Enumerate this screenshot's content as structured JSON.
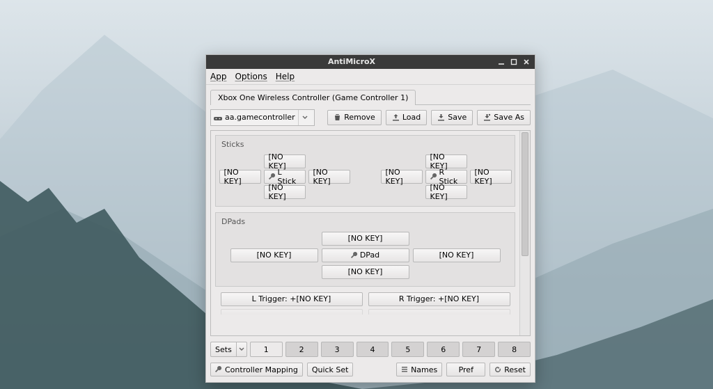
{
  "window": {
    "title": "AntiMicroX"
  },
  "menubar": {
    "app": "App",
    "options": "Options",
    "help": "Help"
  },
  "tab": {
    "label": "Xbox One Wireless Controller (Game Controller 1)"
  },
  "profile_combo": {
    "value": "aa.gamecontroller"
  },
  "toolbar": {
    "remove": "Remove",
    "load": "Load",
    "save": "Save",
    "save_as": "Save As"
  },
  "groups": {
    "sticks": {
      "title": "Sticks",
      "left": {
        "up": "[NO KEY]",
        "left": "[NO KEY]",
        "center": "L Stick",
        "right": "[NO KEY]",
        "down": "[NO KEY]"
      },
      "right": {
        "up": "[NO KEY]",
        "left": "[NO KEY]",
        "center": "R Stick",
        "right": "[NO KEY]",
        "down": "[NO KEY]"
      }
    },
    "dpads": {
      "title": "DPads",
      "up": "[NO KEY]",
      "left": "[NO KEY]",
      "center": "DPad",
      "right": "[NO KEY]",
      "down": "[NO KEY]"
    },
    "triggers": {
      "left": "L Trigger: +[NO KEY]",
      "right": "R Trigger: +[NO KEY]"
    }
  },
  "sets": {
    "label": "Sets",
    "buttons": [
      "1",
      "2",
      "3",
      "4",
      "5",
      "6",
      "7",
      "8"
    ],
    "active_index": 0
  },
  "footer": {
    "controller_mapping": "Controller Mapping",
    "quick_set": "Quick Set",
    "names": "Names",
    "pref": "Pref",
    "reset": "Reset"
  }
}
